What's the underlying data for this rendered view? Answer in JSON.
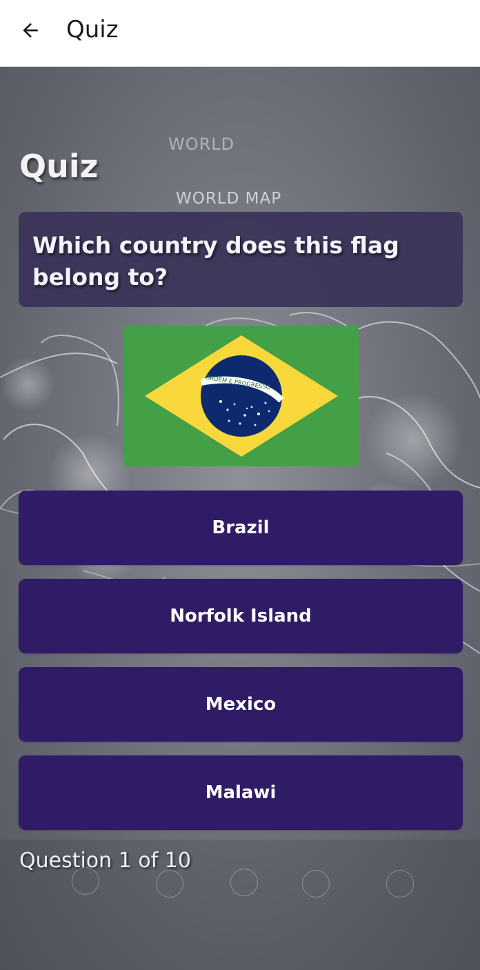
{
  "app_bar": {
    "title": "Quiz",
    "back_icon": "arrow-left-icon"
  },
  "background": {
    "top_word": "WORLD",
    "map_word": "WORLD MAP"
  },
  "screen": {
    "title": "Quiz"
  },
  "question": {
    "text": "Which country does this flag belong to?",
    "flag_icon": "brazil-flag",
    "flag_banner_text": "ORDEM E PROGRESSO"
  },
  "answers": [
    {
      "label": "Brazil"
    },
    {
      "label": "Norfolk Island"
    },
    {
      "label": "Mexico"
    },
    {
      "label": "Malawi"
    }
  ],
  "progress": {
    "text": "Question 1 of 10",
    "current": 1,
    "total": 10
  },
  "colors": {
    "answer_button": "#2f1b66",
    "question_card": "#3a3258",
    "flag_green": "#43a046",
    "flag_yellow": "#f9d83c",
    "flag_blue": "#0e2a6e"
  }
}
